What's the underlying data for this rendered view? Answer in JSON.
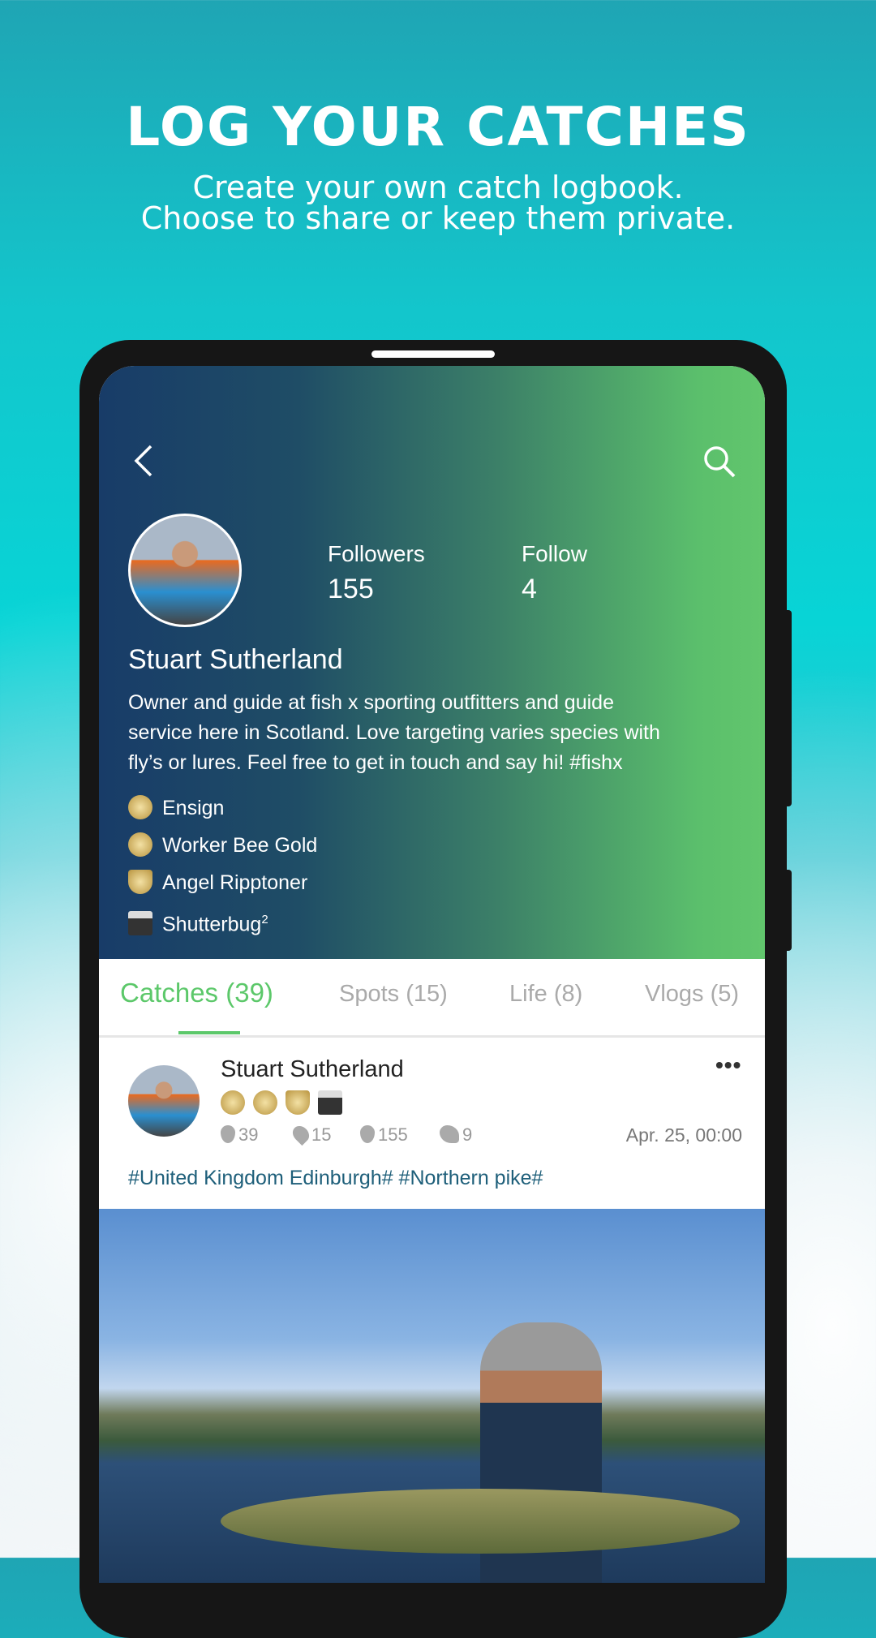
{
  "promo": {
    "title": "LOG YOUR CATCHES",
    "line1": "Create your own catch logbook.",
    "line2": "Choose to share or keep them private."
  },
  "profile": {
    "followers_label": "Followers",
    "followers": "155",
    "follow_label": "Follow",
    "follow": "4",
    "name": "Stuart Sutherland",
    "bio": [
      "Owner and guide at fish x sporting outfitters and guide",
      "service here in Scotland. Love targeting varies species with",
      "fly’s or lures. Feel free to get in touch and say hi! #fishx"
    ],
    "badges": [
      {
        "label": "Ensign",
        "icon": "ensign-badge"
      },
      {
        "label": "Worker Bee Gold",
        "icon": "worker-bee-badge"
      },
      {
        "label": "Angel Ripptoner",
        "icon": "shield-badge"
      },
      {
        "label": "Shutterbug",
        "sup": "2",
        "icon": "camera-badge"
      }
    ]
  },
  "tabs": [
    {
      "label": "Catches (39)",
      "active": true
    },
    {
      "label": "Spots (15)"
    },
    {
      "label": "Life (8)"
    },
    {
      "label": "Vlogs (5)"
    }
  ],
  "post": {
    "author": "Stuart Sutherland",
    "stats": {
      "catches": "39",
      "spots": "15",
      "followers": "155",
      "fish": "9"
    },
    "date": "Apr. 25, 00:00",
    "tags": "#United Kingdom Edinburgh# #Northern pike#"
  },
  "colors": {
    "accent": "#5cc86a",
    "tag": "#1e5f7a"
  }
}
